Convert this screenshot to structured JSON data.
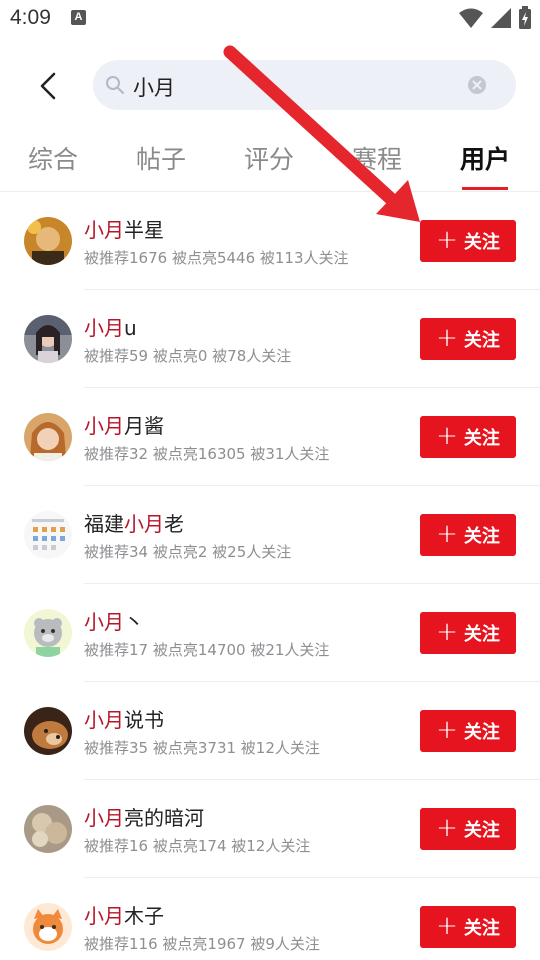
{
  "status_bar": {
    "time": "4:09",
    "notification_icon": "A"
  },
  "search": {
    "query": "小月",
    "back_icon": "chevron-left-icon",
    "search_icon": "search-icon",
    "clear_icon": "clear-icon"
  },
  "tabs": [
    {
      "label": "综合",
      "active": false
    },
    {
      "label": "帖子",
      "active": false
    },
    {
      "label": "评分",
      "active": false
    },
    {
      "label": "赛程",
      "active": false
    },
    {
      "label": "用户",
      "active": true
    }
  ],
  "follow_label": "关注",
  "accent_color": "#e5141e",
  "highlight_color": "#b5162a",
  "users": [
    {
      "prefix": "",
      "highlight": "小月",
      "suffix": "半星",
      "stats": "被推荐1676 被点亮5446 被113人关注"
    },
    {
      "prefix": "",
      "highlight": "小月",
      "suffix": "u",
      "stats": "被推荐59 被点亮0 被78人关注"
    },
    {
      "prefix": "",
      "highlight": "小月",
      "suffix": "月酱",
      "stats": "被推荐32 被点亮16305 被31人关注"
    },
    {
      "prefix": "福建",
      "highlight": "小月",
      "suffix": "老",
      "stats": "被推荐34 被点亮2 被25人关注"
    },
    {
      "prefix": "",
      "highlight": "小月",
      "suffix": "丶",
      "stats": "被推荐17 被点亮14700 被21人关注"
    },
    {
      "prefix": "",
      "highlight": "小月",
      "suffix": "说书",
      "stats": "被推荐35 被点亮3731 被12人关注"
    },
    {
      "prefix": "",
      "highlight": "小月",
      "suffix": "亮的暗河",
      "stats": "被推荐16 被点亮174 被12人关注"
    },
    {
      "prefix": "",
      "highlight": "小月",
      "suffix": "木子",
      "stats": "被推荐116 被点亮1967 被9人关注"
    }
  ]
}
